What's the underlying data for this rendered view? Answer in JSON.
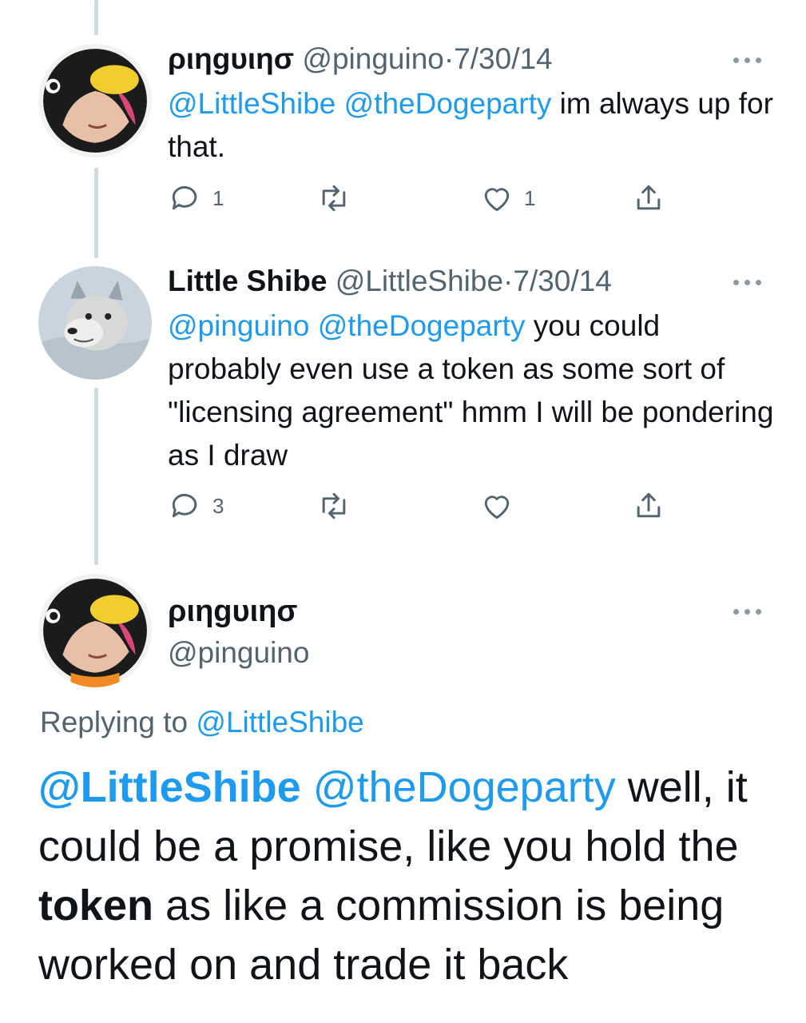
{
  "colors": {
    "accent": "#1d9bf0",
    "secondary_text": "#536471",
    "thread_line": "#cfd9de"
  },
  "tweets": [
    {
      "avatar_icon": "penguin-hat-avatar",
      "name": "ριηgυιησ",
      "handle": "@pinguino",
      "separator": "·",
      "date": "7/30/14",
      "body": {
        "mention1": "@LittleShibe",
        "mention2": "@theDogeparty",
        "text": " im always up for that."
      },
      "actions": {
        "reply_count": "1",
        "retweet_count": "",
        "like_count": "1"
      }
    },
    {
      "avatar_icon": "shiba-dog-avatar",
      "name": "Little Shibe",
      "handle": "@LittleShibe",
      "separator": "·",
      "date": "7/30/14",
      "body": {
        "mention1": "@pinguino",
        "mention2": "@theDogeparty",
        "text": " you could probably even use a token as some sort of \"licensing agreement\" hmm I will be pondering as I draw"
      },
      "actions": {
        "reply_count": "3",
        "retweet_count": "",
        "like_count": ""
      }
    }
  ],
  "focus_tweet": {
    "avatar_icon": "penguin-hat-avatar",
    "name": "ριηgυιησ",
    "handle": "@pinguino",
    "replying_prefix": "Replying to ",
    "replying_to": "@LittleShibe",
    "body": {
      "mention1": "@LittleShibe",
      "mention2": "@theDogeparty",
      "text1": " well, it could be a promise, like you hold the ",
      "bold": "token",
      "text2": " as like a commission is being worked on and trade it back"
    }
  }
}
